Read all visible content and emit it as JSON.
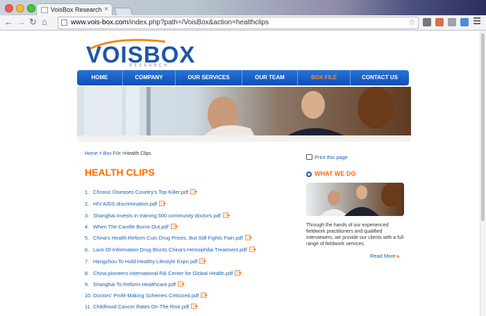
{
  "browser": {
    "tab_title": "VoisBox Research",
    "url_host": "www.vois-box.com",
    "url_path": "/index.php?path=/VoisBox&action=healthclips"
  },
  "logo": {
    "text": "VOISBOX",
    "subtitle": "RESEARCH"
  },
  "nav": [
    "HOME",
    "COMPANY",
    "OUR SERVICES",
    "OUR TEAM",
    "BOX FILE",
    "CONTACT US"
  ],
  "nav_active": "BOX FILE",
  "breadcrumb": {
    "home": "Home",
    "sep1": " > ",
    "boxfile": "Box File",
    "sep2": " >",
    "current": "Health Clips"
  },
  "page_title": "HEALTH CLIPS",
  "clips": [
    "Chronic Diseases Country's Top Killer.pdf",
    "HIV AIDS discrimination.pdf",
    "Shanghai invests in training 500 community doctors.pdf",
    "When The Candle Burns Out.pdf",
    "China's Health Reform Cuts Drug Prices, But Still Fights Pain.pdf",
    "Lack Of Information Drug Blunts China's Hemophilia Treatment.pdf",
    "Hangzhou To Hold Healthy Lifestyle Expo.pdf",
    "China pioneers international R& Center for Global Health.pdf",
    "Shanghai To Reform Healthcare.pdf",
    "Doctors' Profit-Making Schemes Criticized.pdf",
    "Childhood Cancer Rates On The Rise.pdf"
  ],
  "sidebar": {
    "print_label": "Print this page",
    "what_we_do": "WHAT WE DO",
    "description": "Through the hands of our experienced fieldwork practitioners and qualified interviewers, we provide our clients with a full range of fieldwork services.",
    "read_more": "Read More"
  }
}
